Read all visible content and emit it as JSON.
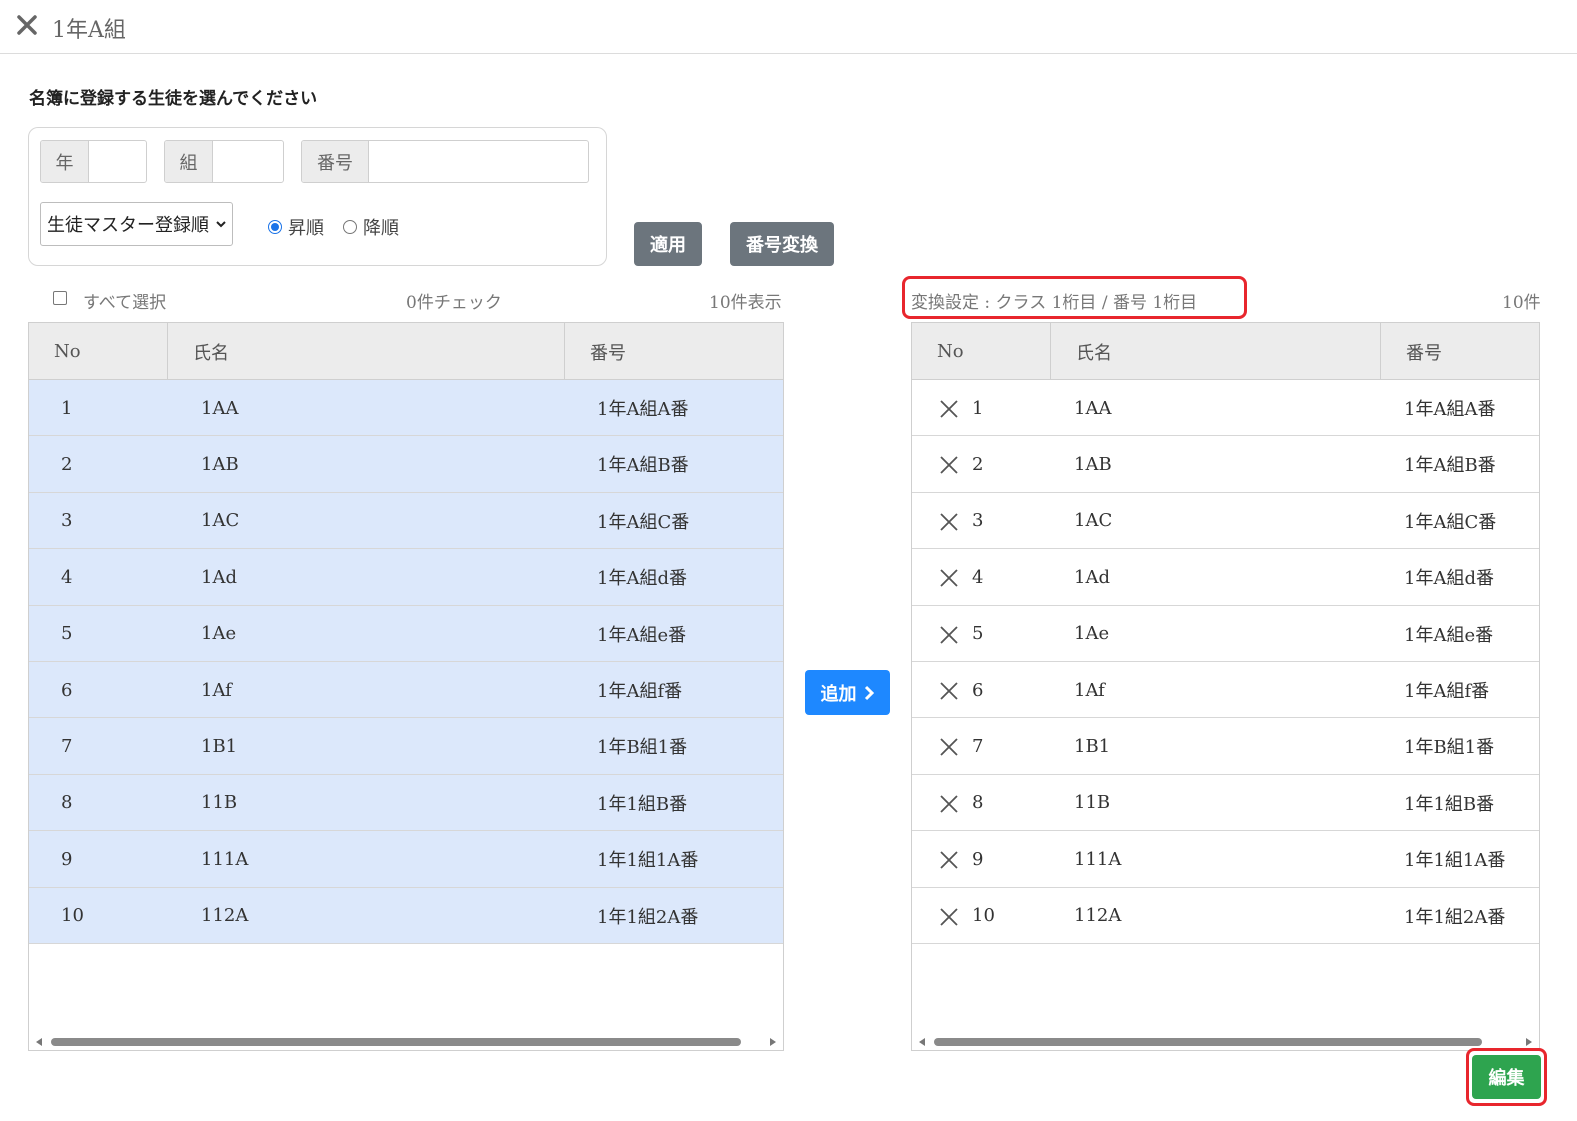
{
  "window": {
    "title": "1年A組"
  },
  "instruction": "名簿に登録する生徒を選んでください",
  "filters": {
    "year_label": "年",
    "year_value": "",
    "class_label": "組",
    "class_value": "",
    "number_label": "番号",
    "number_value": "",
    "sort_select": "生徒マスター登録順",
    "radio_asc": "昇順",
    "radio_desc": "降順",
    "radio_selected": "昇順"
  },
  "buttons": {
    "apply": "適用",
    "convert": "番号変換",
    "add": "追加",
    "edit": "編集"
  },
  "left_panel": {
    "select_all": "すべて選択",
    "checked_count": "0件チェック",
    "shown_count": "10件表示",
    "columns": [
      "No",
      "氏名",
      "番号"
    ],
    "rows": [
      {
        "no": "1",
        "name": "1AA",
        "number": "1年A組A番"
      },
      {
        "no": "2",
        "name": "1AB",
        "number": "1年A組B番"
      },
      {
        "no": "3",
        "name": "1AC",
        "number": "1年A組C番"
      },
      {
        "no": "4",
        "name": "1Ad",
        "number": "1年A組d番"
      },
      {
        "no": "5",
        "name": "1Ae",
        "number": "1年A組e番"
      },
      {
        "no": "6",
        "name": "1Af",
        "number": "1年A組f番"
      },
      {
        "no": "7",
        "name": "1B1",
        "number": "1年B組1番"
      },
      {
        "no": "8",
        "name": "11B",
        "number": "1年1組B番"
      },
      {
        "no": "9",
        "name": "111A",
        "number": "1年1組1A番"
      },
      {
        "no": "10",
        "name": "112A",
        "number": "1年1組2A番"
      }
    ]
  },
  "right_panel": {
    "conversion_setting": "変換設定 : クラス 1桁目 / 番号 1桁目",
    "count": "10件",
    "columns": [
      "No",
      "氏名",
      "番号"
    ],
    "rows": [
      {
        "no": "1",
        "name": "1AA",
        "number": "1年A組A番"
      },
      {
        "no": "2",
        "name": "1AB",
        "number": "1年A組B番"
      },
      {
        "no": "3",
        "name": "1AC",
        "number": "1年A組C番"
      },
      {
        "no": "4",
        "name": "1Ad",
        "number": "1年A組d番"
      },
      {
        "no": "5",
        "name": "1Ae",
        "number": "1年A組e番"
      },
      {
        "no": "6",
        "name": "1Af",
        "number": "1年A組f番"
      },
      {
        "no": "7",
        "name": "1B1",
        "number": "1年B組1番"
      },
      {
        "no": "8",
        "name": "11B",
        "number": "1年1組B番"
      },
      {
        "no": "9",
        "name": "111A",
        "number": "1年1組1A番"
      },
      {
        "no": "10",
        "name": "112A",
        "number": "1年1組2A番"
      }
    ]
  },
  "colors": {
    "selected_row": "#dce8fb",
    "highlight_border": "#e8262d",
    "add_button": "#1e88ff",
    "edit_button": "#2ea44f",
    "gray_button": "#6c757d"
  }
}
